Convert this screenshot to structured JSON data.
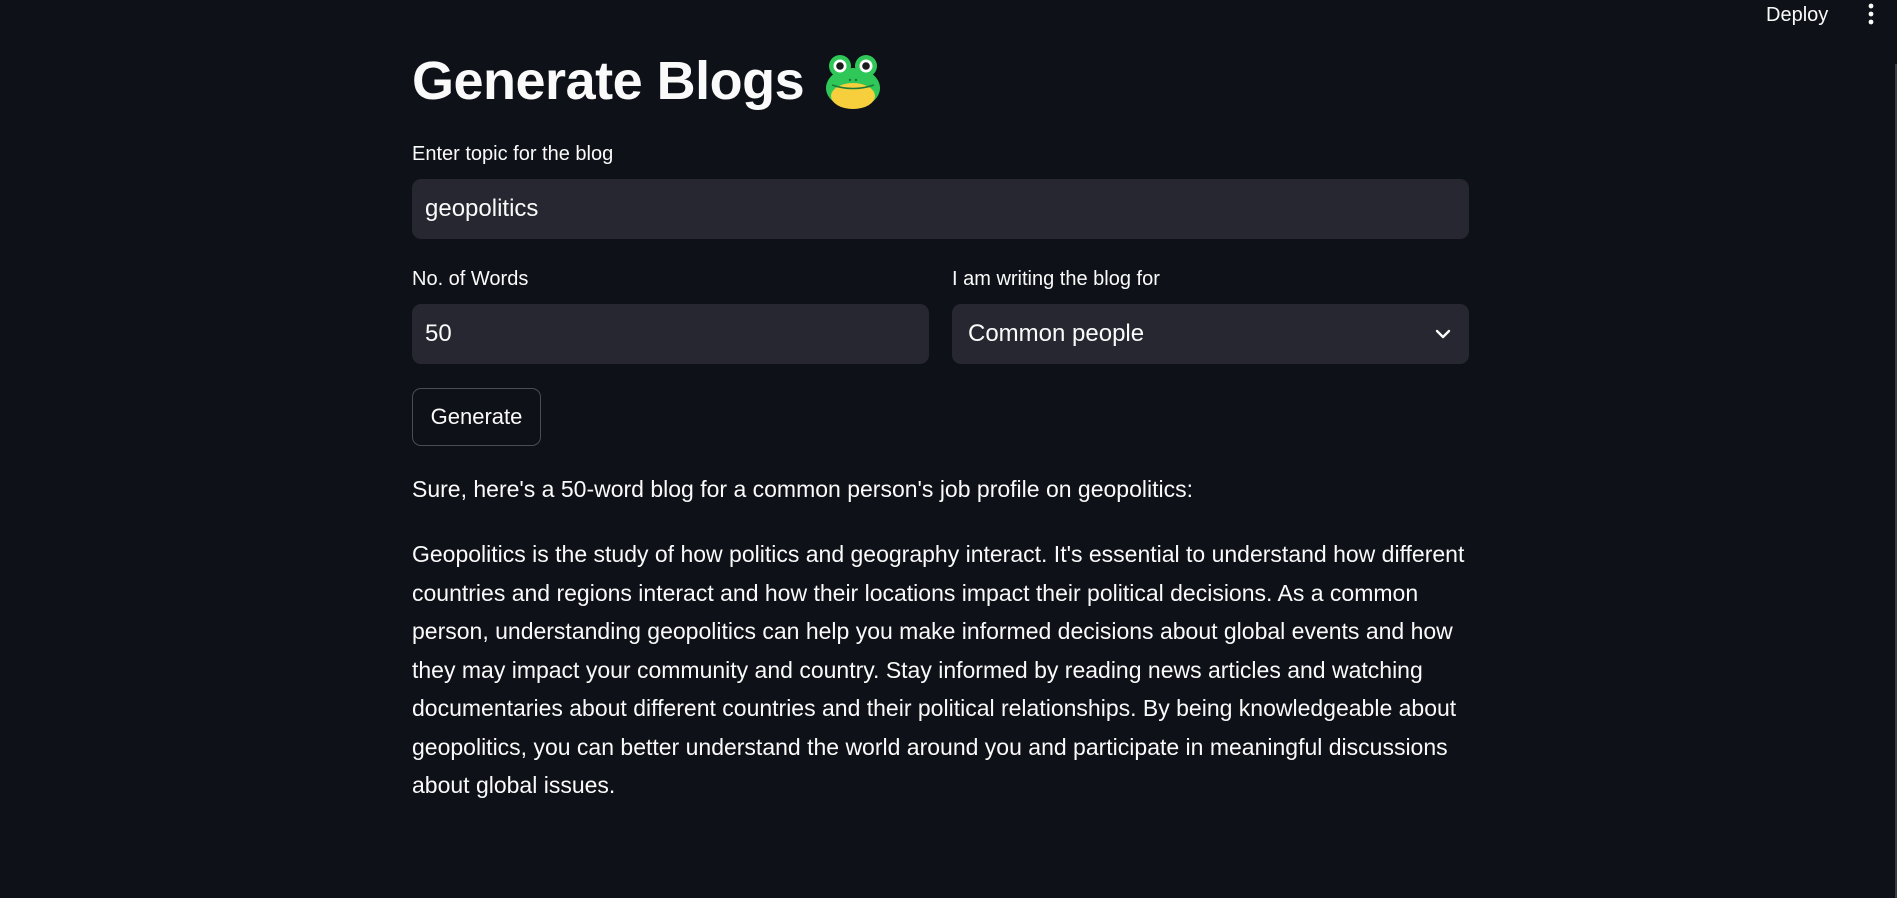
{
  "header": {
    "deploy_label": "Deploy",
    "menu_icon": "vertical-ellipsis-icon"
  },
  "page": {
    "title": "Generate Blogs",
    "title_icon": "frog-icon"
  },
  "form": {
    "topic_label": "Enter topic for the blog",
    "topic_value": "geopolitics",
    "words_label": "No. of Words",
    "words_value": "50",
    "audience_label": "I am writing the blog for",
    "audience_value": "Common people",
    "generate_label": "Generate"
  },
  "output": {
    "intro": "Sure, here's a 50-word blog for a common person's job profile on geopolitics:",
    "body": "Geopolitics is the study of how politics and geography interact. It's essential to understand how different countries and regions interact and how their locations impact their political decisions. As a common person, understanding geopolitics can help you make informed decisions about global events and how they may impact your community and country. Stay informed by reading news articles and watching documentaries about different countries and their political relationships. By being knowledgeable about geopolitics, you can better understand the world around you and participate in meaningful discussions about global issues."
  },
  "colors": {
    "background": "#0e1117",
    "input_background": "#262730",
    "text": "#fafafa",
    "frog_green": "#2fc757",
    "frog_yellow": "#f7cf3c"
  }
}
